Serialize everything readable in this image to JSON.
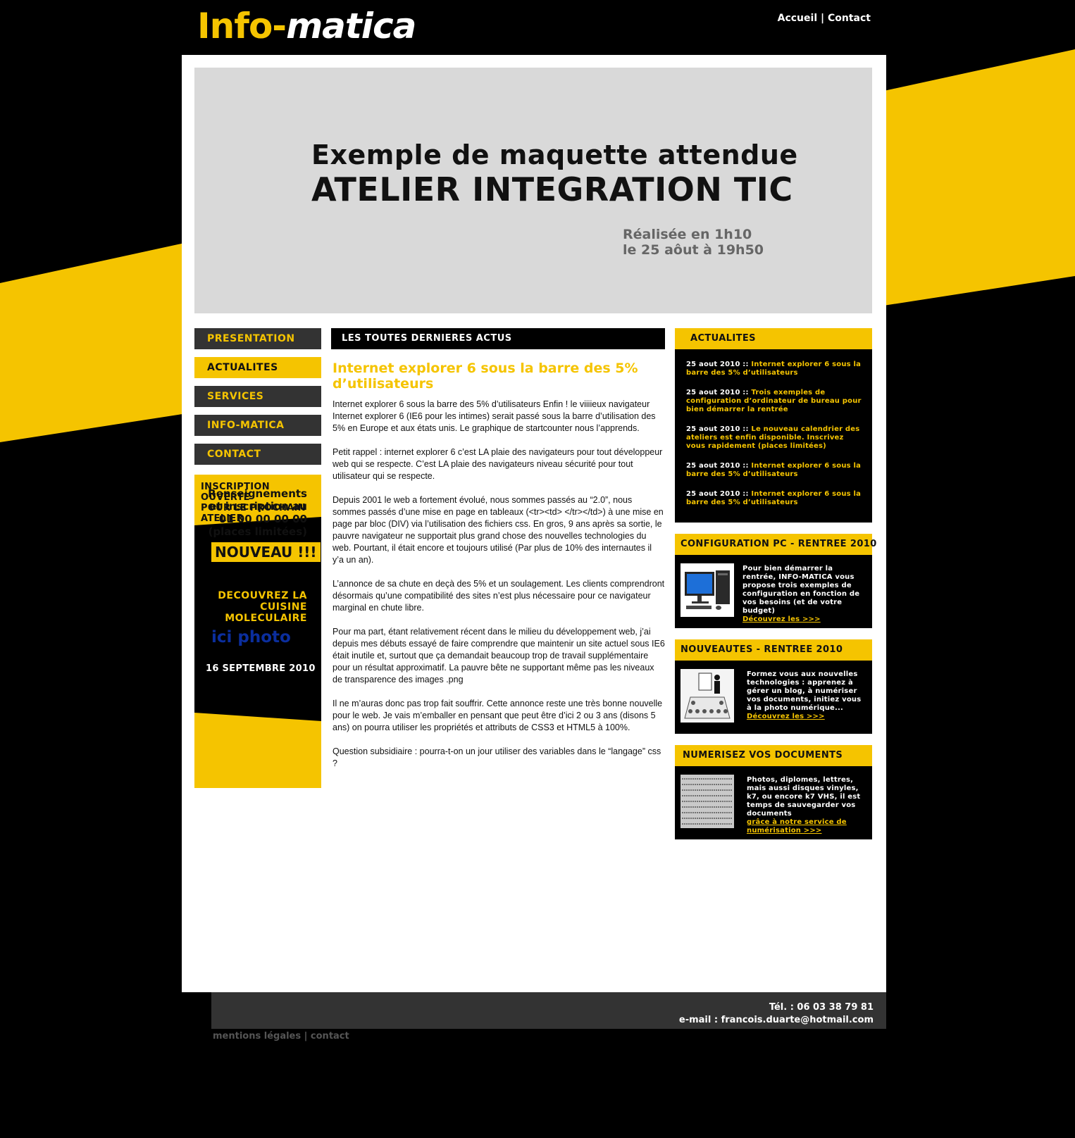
{
  "colors": {
    "accent": "#f5c400",
    "dark": "#333333",
    "background": "#000000",
    "panel": "#d9d9d9"
  },
  "header": {
    "logo_part1": "Info-",
    "logo_part2": "matica",
    "nav": [
      "Accueil",
      "Contact"
    ],
    "nav_sep": " | "
  },
  "banner": {
    "line1": "Exemple de maquette attendue",
    "line2": "ATELIER INTEGRATION TIC",
    "line3": "Réalisée en 1h10",
    "line4": "le 25 aôut à 19h50"
  },
  "leftnav": {
    "items": [
      {
        "label": "PRESENTATION"
      },
      {
        "label": "ACTUALITES"
      },
      {
        "label": "SERVICES"
      },
      {
        "label": "INFO-MATICA"
      },
      {
        "label": "CONTACT"
      }
    ]
  },
  "promo": {
    "top_line1": "INSCRIPTION OUVERTE",
    "top_line2": "POUR LE PROCHAIN",
    "top_line3": "ATELIER",
    "badge": "NOUVEAU !!!",
    "discover1": "DECOUVREZ LA",
    "discover2": "CUISINE",
    "discover3": "MOLECULAIRE",
    "photo": "ici photo",
    "date": "16 SEPTEMBRE 2010",
    "bottom1": "Renseignements",
    "bottom2": "et inscription au",
    "bottom3": "01 00 00 00 00",
    "bottom4": "(places limitées)"
  },
  "main": {
    "section_title": "LES TOUTES DERNIERES ACTUS",
    "article_title": "Internet explorer 6 sous la barre des 5% d’utilisateurs",
    "paragraphs": [
      "Internet explorer 6 sous la barre des 5% d’utilisateurs Enfin ! le viiiieux navigateur Internet explorer 6 (IE6 pour les intimes) serait passé sous la barre d’utilisation des 5% en Europe et aux états unis. Le graphique de startcounter nous l’apprends.",
      "Petit rappel : internet explorer 6 c’est LA plaie des navigateurs pour tout développeur web qui se respecte. C’est LA plaie des navigateurs niveau sécurité pour tout utilisateur qui se respecte.",
      "Depuis 2001 le web a fortement évolué, nous sommes passés au “2.0”, nous sommes passés d’une mise en page en tableaux (<tr><td> </tr></td>) à une mise en page par bloc (DIV) via l’utilisation des fichiers css. En gros, 9 ans après sa sortie, le pauvre navigateur ne supportait plus grand chose des nouvelles technologies du web. Pourtant, il était encore et toujours utilisé (Par plus de 10% des internautes il y’a un an).",
      "L’annonce de sa chute en deçà des 5% et un soulagement. Les clients comprendront désormais qu’une compatibilité des sites n’est plus nécessaire pour ce navigateur marginal en chute libre.",
      "Pour ma part, étant relativement récent dans le milieu du développement web, j’ai depuis mes débuts essayé de faire comprendre que maintenir un site actuel sous IE6 était inutile et, surtout que ça demandait beaucoup trop de travail supplémentaire pour un résultat approximatif. La pauvre bête ne supportant même pas les niveaux de transparence des images .png",
      "Il ne m’auras donc pas trop fait souffrir. Cette annonce reste une très bonne nouvelle pour le web. Je vais m’emballer en pensant que peut être d’ici 2 ou 3 ans (disons 5 ans) on pourra utiliser les propriétés et attributs de CSS3 et HTML5 à 100%.",
      "Question subsidiaire : pourra-t-on un jour utiliser des variables dans le “langage” css ?"
    ]
  },
  "sidebar": {
    "actus_title": "ACTUALITES",
    "actus": [
      {
        "date": "25 aout 2010 :: ",
        "text": "Internet explorer 6 sous la barre des 5% d’utilisateurs"
      },
      {
        "date": "25 aout 2010 :: ",
        "text": "Trois exemples de configuration d’ordinateur de bureau pour bien démarrer la rentrée"
      },
      {
        "date": "25 aout 2010 :: ",
        "text": "Le nouveau calendrier des ateliers est enfin disponible. Inscrivez vous rapidement (places limitées)"
      },
      {
        "date": "25 aout 2010 :: ",
        "text": "Internet explorer 6 sous la barre des 5% d’utilisateurs"
      },
      {
        "date": "25 aout 2010 :: ",
        "text": "Internet explorer 6 sous la barre des 5% d’utilisateurs"
      }
    ],
    "config": {
      "title": "CONFIGURATION PC - RENTREE 2010",
      "text": "Pour bien démarrer la rentrée, INFO-MATICA vous propose trois exemples de configuration en fonction de vos besoins (et de votre budget)",
      "link": "Découvrez les >>>"
    },
    "nouveautes": {
      "title": "NOUVEAUTES - RENTREE 2010",
      "text": "Formez vous aux nouvelles technologies : apprenez à gérer un blog, à numériser vos documents, initiez vous à la photo numérique...",
      "link": "Découvrez les >>>"
    },
    "numerisez": {
      "title": "NUMERISEZ VOS DOCUMENTS",
      "text": "Photos, diplomes, lettres, mais aussi disques vinyles, k7, ou encore k7 VHS, il est temps de sauvegarder vos documents",
      "link": "grâce à notre service de numérisation  >>>"
    }
  },
  "footer": {
    "tel": "Tél. : 06 03 38 79 81",
    "email": "e-mail : francois.duarte@hotmail.com",
    "links": [
      "mentions légales",
      "contact"
    ],
    "sep": " | "
  }
}
